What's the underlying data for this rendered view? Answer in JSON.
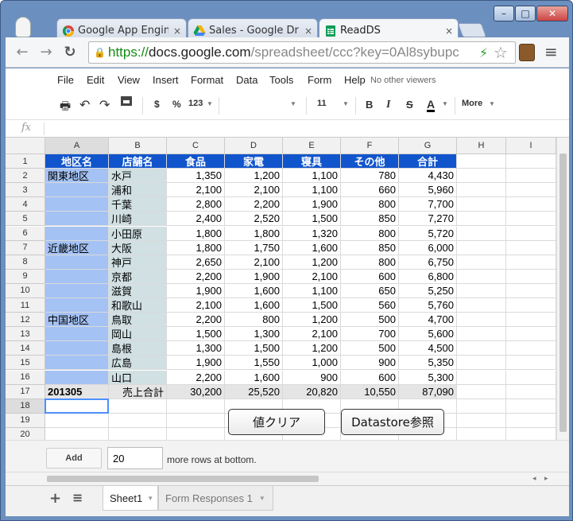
{
  "browser": {
    "tabs": [
      {
        "label": "Google App Engine",
        "close": "×"
      },
      {
        "label": "Sales - Google Drive",
        "close": "×"
      },
      {
        "label": "ReadDS",
        "close": "×"
      }
    ],
    "url": {
      "scheme": "https://",
      "host": "docs.google.com",
      "path": "/spreadsheet/ccc?key=0Al8sybupc"
    },
    "caption": {
      "minimize": "–",
      "maximize": "□",
      "close": "✕"
    }
  },
  "menu": {
    "items": [
      "File",
      "Edit",
      "View",
      "Insert",
      "Format",
      "Data",
      "Tools",
      "Form",
      "Help"
    ],
    "viewers": "No other viewers"
  },
  "format_toolbar": {
    "currency": "$",
    "percent": "%",
    "number_format": "123",
    "font_size": "11",
    "bold": "B",
    "italic": "I",
    "strike": "S",
    "text_color": "A",
    "more": "More"
  },
  "formula_bar": {
    "fx": "fx",
    "value": ""
  },
  "grid": {
    "columns": [
      "A",
      "B",
      "C",
      "D",
      "E",
      "F",
      "G",
      "H",
      "I"
    ],
    "header_row": [
      "地区名",
      "店舗名",
      "食品",
      "家電",
      "寝具",
      "その他",
      "合計"
    ],
    "rows": [
      {
        "n": "2",
        "region": "関東地区",
        "store": "水戸",
        "food": "1,350",
        "elec": "1,200",
        "bed": "1,100",
        "other": "780",
        "total": "4,430"
      },
      {
        "n": "3",
        "region": "",
        "store": "浦和",
        "food": "2,100",
        "elec": "2,100",
        "bed": "1,100",
        "other": "660",
        "total": "5,960"
      },
      {
        "n": "4",
        "region": "",
        "store": "千葉",
        "food": "2,800",
        "elec": "2,200",
        "bed": "1,900",
        "other": "800",
        "total": "7,700"
      },
      {
        "n": "5",
        "region": "",
        "store": "川崎",
        "food": "2,400",
        "elec": "2,520",
        "bed": "1,500",
        "other": "850",
        "total": "7,270"
      },
      {
        "n": "6",
        "region": "",
        "store": "小田原",
        "food": "1,800",
        "elec": "1,800",
        "bed": "1,320",
        "other": "800",
        "total": "5,720"
      },
      {
        "n": "7",
        "region": "近畿地区",
        "store": "大阪",
        "food": "1,800",
        "elec": "1,750",
        "bed": "1,600",
        "other": "850",
        "total": "6,000"
      },
      {
        "n": "8",
        "region": "",
        "store": "神戸",
        "food": "2,650",
        "elec": "2,100",
        "bed": "1,200",
        "other": "800",
        "total": "6,750"
      },
      {
        "n": "9",
        "region": "",
        "store": "京都",
        "food": "2,200",
        "elec": "1,900",
        "bed": "2,100",
        "other": "600",
        "total": "6,800"
      },
      {
        "n": "10",
        "region": "",
        "store": "滋賀",
        "food": "1,900",
        "elec": "1,600",
        "bed": "1,100",
        "other": "650",
        "total": "5,250"
      },
      {
        "n": "11",
        "region": "",
        "store": "和歌山",
        "food": "2,100",
        "elec": "1,600",
        "bed": "1,500",
        "other": "560",
        "total": "5,760"
      },
      {
        "n": "12",
        "region": "中国地区",
        "store": "鳥取",
        "food": "2,200",
        "elec": "800",
        "bed": "1,200",
        "other": "500",
        "total": "4,700"
      },
      {
        "n": "13",
        "region": "",
        "store": "岡山",
        "food": "1,500",
        "elec": "1,300",
        "bed": "2,100",
        "other": "700",
        "total": "5,600"
      },
      {
        "n": "14",
        "region": "",
        "store": "島根",
        "food": "1,300",
        "elec": "1,500",
        "bed": "1,200",
        "other": "500",
        "total": "4,500"
      },
      {
        "n": "15",
        "region": "",
        "store": "広島",
        "food": "1,900",
        "elec": "1,550",
        "bed": "1,000",
        "other": "900",
        "total": "5,350"
      },
      {
        "n": "16",
        "region": "",
        "store": "山口",
        "food": "2,200",
        "elec": "1,600",
        "bed": "900",
        "other": "600",
        "total": "5,300"
      }
    ],
    "total_row": {
      "n": "17",
      "label": "201305",
      "name": "売上合計",
      "food": "30,200",
      "elec": "25,520",
      "bed": "20,820",
      "other": "10,550",
      "total": "87,090"
    },
    "empty_rows": [
      "18",
      "19",
      "20"
    ],
    "selected_cell": "A18"
  },
  "buttons": {
    "clear": "値クリア",
    "datastore": "Datastore参照"
  },
  "add_rows": {
    "button": "Add",
    "count": "20",
    "suffix": "more rows at bottom."
  },
  "sheets": {
    "tabs": [
      "Sheet1",
      "Form Responses 1"
    ],
    "add": "+",
    "list": "≡"
  },
  "colors": {
    "header_blue": "#1155cc",
    "region_blue": "#a4c2f4",
    "store_teal": "#d0e0e3",
    "total_gray": "#e5e5e5"
  }
}
